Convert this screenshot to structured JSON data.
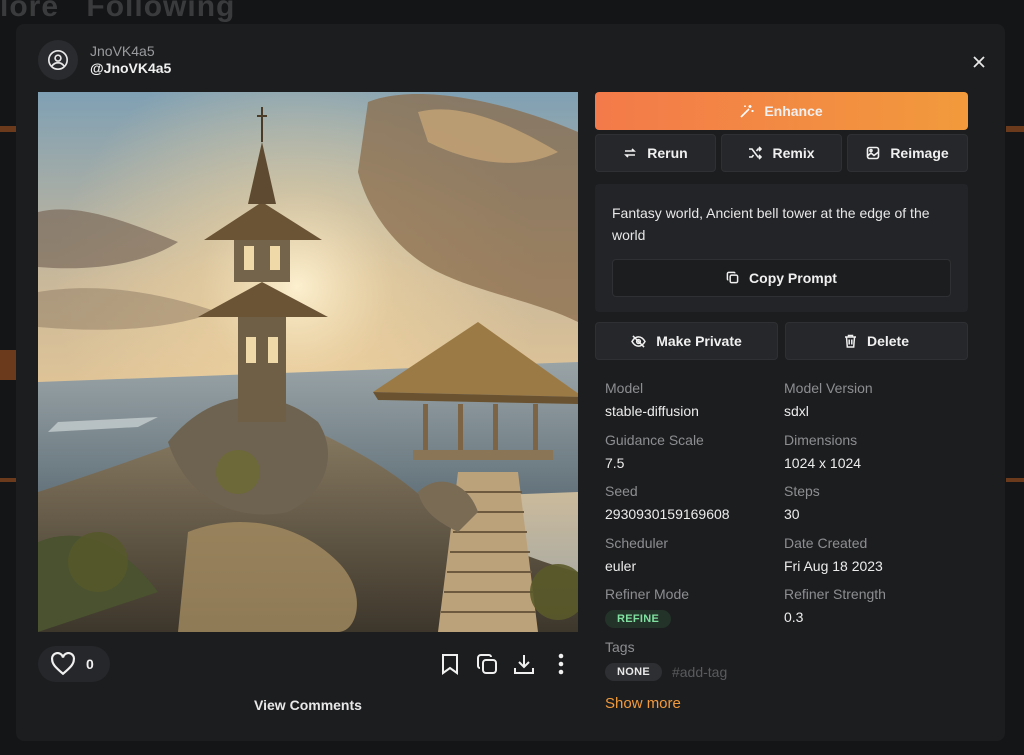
{
  "background": {
    "tabs": [
      "lore",
      "Following"
    ]
  },
  "user": {
    "username": "JnoVK4a5",
    "handle": "@JnoVK4a5"
  },
  "actions": {
    "enhance": "Enhance",
    "rerun": "Rerun",
    "remix": "Remix",
    "reimage": "Reimage",
    "copy_prompt": "Copy Prompt",
    "make_private": "Make Private",
    "delete": "Delete"
  },
  "prompt": "Fantasy world, Ancient bell tower at the edge of the world",
  "likes": "0",
  "view_comments": "View Comments",
  "metadata": [
    {
      "label": "Model",
      "value": "stable-diffusion"
    },
    {
      "label": "Model Version",
      "value": "sdxl"
    },
    {
      "label": "Guidance Scale",
      "value": "7.5"
    },
    {
      "label": "Dimensions",
      "value": "1024 x 1024"
    },
    {
      "label": "Seed",
      "value": "2930930159169608"
    },
    {
      "label": "Steps",
      "value": "30"
    },
    {
      "label": "Scheduler",
      "value": "euler"
    },
    {
      "label": "Date Created",
      "value": "Fri Aug 18 2023"
    },
    {
      "label": "Refiner Mode",
      "value": "REFINE"
    },
    {
      "label": "Refiner Strength",
      "value": "0.3"
    }
  ],
  "tags": {
    "label": "Tags",
    "items": [
      "NONE"
    ],
    "add_placeholder": "#add-tag"
  },
  "show_more": "Show more",
  "colors": {
    "accent": "#f29a3c",
    "enhance_start": "#f37a4a",
    "refine_badge": "#7fe0a0"
  }
}
